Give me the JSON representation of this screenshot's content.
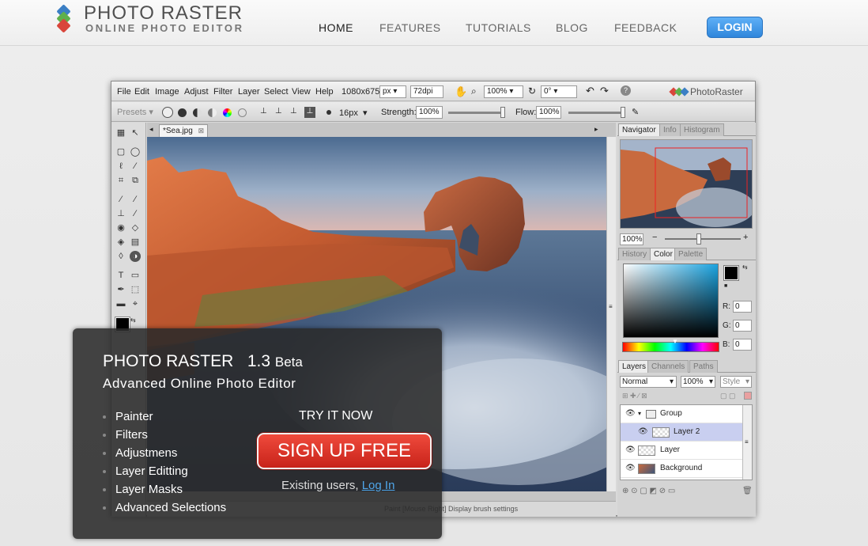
{
  "header": {
    "logo_title": "PHOTO RASTER",
    "logo_subtitle": "ONLINE PHOTO EDITOR",
    "nav": [
      "HOME",
      "FEATURES",
      "TUTORIALS",
      "BLOG",
      "FEEDBACK"
    ],
    "login_label": "LOGIN"
  },
  "app": {
    "menu": [
      "File",
      "Edit",
      "Image",
      "Adjust",
      "Filter",
      "Layer",
      "Select",
      "View",
      "Help"
    ],
    "image_size": "1080x675",
    "unit": "px",
    "dpi": "72dpi",
    "zoom": "100%",
    "rotation": "0°",
    "brand": "PhotoRaster",
    "presets_label": "Presets",
    "brush_size": "16px",
    "strength_label": "Strength:",
    "strength_value": "100%",
    "flow_label": "Flow:",
    "flow_value": "100%",
    "document_tab": "*Sea.jpg",
    "status_text": "Paint   [Mouse Right] Display brush settings"
  },
  "panels": {
    "top_tabs": [
      "Navigator",
      "Info",
      "Histogram"
    ],
    "navigator_zoom": "100%",
    "color_tabs": [
      "History",
      "Color",
      "Palette"
    ],
    "rgb": {
      "r_label": "R:",
      "r": "0",
      "g_label": "G:",
      "g": "0",
      "b_label": "B:",
      "b": "0"
    },
    "layer_tabs": [
      "Layers",
      "Channels",
      "Paths"
    ],
    "blend_mode": "Normal",
    "opacity": "100%",
    "style_label": "Style",
    "layers": [
      "Group",
      "Layer 2",
      "Layer",
      "Background"
    ]
  },
  "promo": {
    "title": "PHOTO RASTER",
    "version": "1.3",
    "stage": "Beta",
    "subtitle": "Advanced Online Photo Editor",
    "features": [
      "Painter",
      "Filters",
      "Adjustmens",
      "Layer Editting",
      "Layer Masks",
      "Advanced Selections"
    ],
    "try_label": "TRY IT NOW",
    "signup_label": "SIGN UP FREE",
    "existing_text": "Existing users,",
    "login_link": "Log In"
  },
  "colors": {
    "accent_blue": "#3a94e6",
    "signup_red": "#d9342a",
    "promo_bg": "#2a2a2a"
  }
}
